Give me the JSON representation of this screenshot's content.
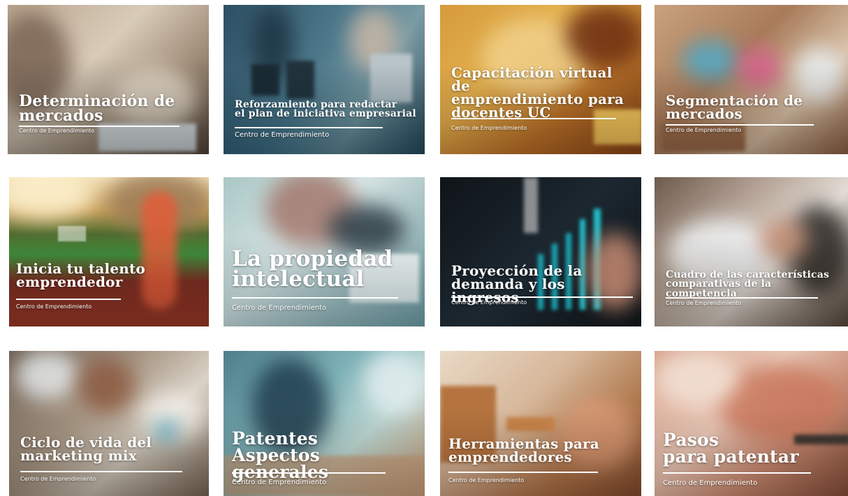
{
  "courses": [
    {
      "title": "Determinación de\nmercados",
      "subtitle": "Centro de Emprendimiento"
    },
    {
      "title": "Reforzamiento para redactar\nel plan de iniciativa empresarial",
      "subtitle": "Centro de Emprendimiento"
    },
    {
      "title": "Capacitación virtual de\nemprendimiento para\ndocentes UC",
      "subtitle": "Centro de Emprendimiento"
    },
    {
      "title": "Segmentación de\nmercados",
      "subtitle": "Centro de Emprendimiento"
    },
    {
      "title": "Inicia tu talento\nemprendedor",
      "subtitle": "Centro de Emprendimiento"
    },
    {
      "title": "La propiedad\nintelectual",
      "subtitle": "Centro de Emprendimiento"
    },
    {
      "title": "Proyección de la\ndemanda y los ingresos",
      "subtitle": "Centro de Emprendimiento"
    },
    {
      "title": "Cuadro de las características\ncomparativas de la competencia",
      "subtitle": "Centro de Emprendimiento"
    },
    {
      "title": "Ciclo de vida del\nmarketing mix",
      "subtitle": "Centro de Emprendimiento"
    },
    {
      "title": "Patentes\nAspectos generales",
      "subtitle": "Centro de Emprendimiento"
    },
    {
      "title": "Herramientas para\nemprendedores",
      "subtitle": "Centro de Emprendimiento"
    },
    {
      "title": "Pasos\npara patentar",
      "subtitle": "Centro de Emprendimiento"
    }
  ]
}
